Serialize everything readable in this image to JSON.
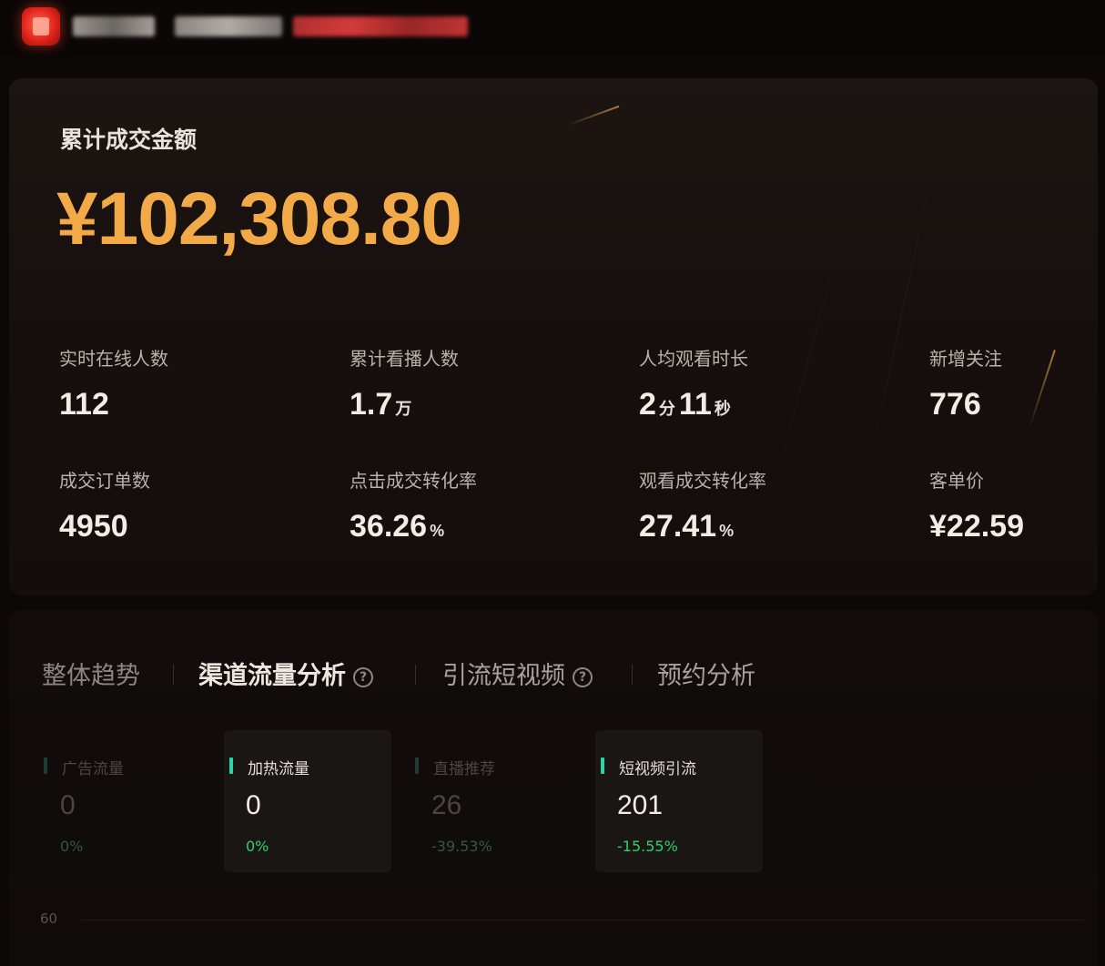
{
  "header": {
    "logo_icon": "app-logo-icon",
    "blurred_texts": [
      "",
      "",
      ""
    ]
  },
  "summary": {
    "total_label": "累计成交金额",
    "total_amount": "¥102,308.80",
    "accent_color": "#f1aa47",
    "metrics": [
      {
        "label": "实时在线人数",
        "value": "112",
        "unit": "",
        "value2": "",
        "unit2": ""
      },
      {
        "label": "累计看播人数",
        "value": "1.7",
        "unit": "万",
        "value2": "",
        "unit2": ""
      },
      {
        "label": "人均观看时长",
        "value": "2",
        "unit": "分",
        "value2": "11",
        "unit2": "秒"
      },
      {
        "label": "新增关注",
        "value": "776",
        "unit": "",
        "value2": "",
        "unit2": ""
      },
      {
        "label": "成交订单数",
        "value": "4950",
        "unit": "",
        "value2": "",
        "unit2": ""
      },
      {
        "label": "点击成交转化率",
        "value": "36.26",
        "unit": "%",
        "value2": "",
        "unit2": ""
      },
      {
        "label": "观看成交转化率",
        "value": "27.41",
        "unit": "%",
        "value2": "",
        "unit2": ""
      },
      {
        "label": "客单价",
        "value": "¥22.59",
        "unit": "",
        "value2": "",
        "unit2": ""
      }
    ]
  },
  "analysis": {
    "tabs": [
      {
        "label": "整体趋势",
        "active": false,
        "help": false
      },
      {
        "label": "渠道流量分析",
        "active": true,
        "help": true
      },
      {
        "label": "引流短视频",
        "active": false,
        "help": true
      },
      {
        "label": "预约分析",
        "active": false,
        "help": false
      }
    ],
    "help_glyph": "?",
    "channels": [
      {
        "name": "广告流量",
        "value": "0",
        "change": "0%",
        "enabled": false
      },
      {
        "name": "加热流量",
        "value": "0",
        "change": "0%",
        "enabled": true
      },
      {
        "name": "直播推荐",
        "value": "26",
        "change": "-39.53%",
        "enabled": false
      },
      {
        "name": "短视频引流",
        "value": "201",
        "change": "-15.55%",
        "enabled": true
      }
    ],
    "positive_color": "#2fd06b",
    "indicator_color": "#2dd4a8",
    "chart_axis_top_label": "60"
  }
}
